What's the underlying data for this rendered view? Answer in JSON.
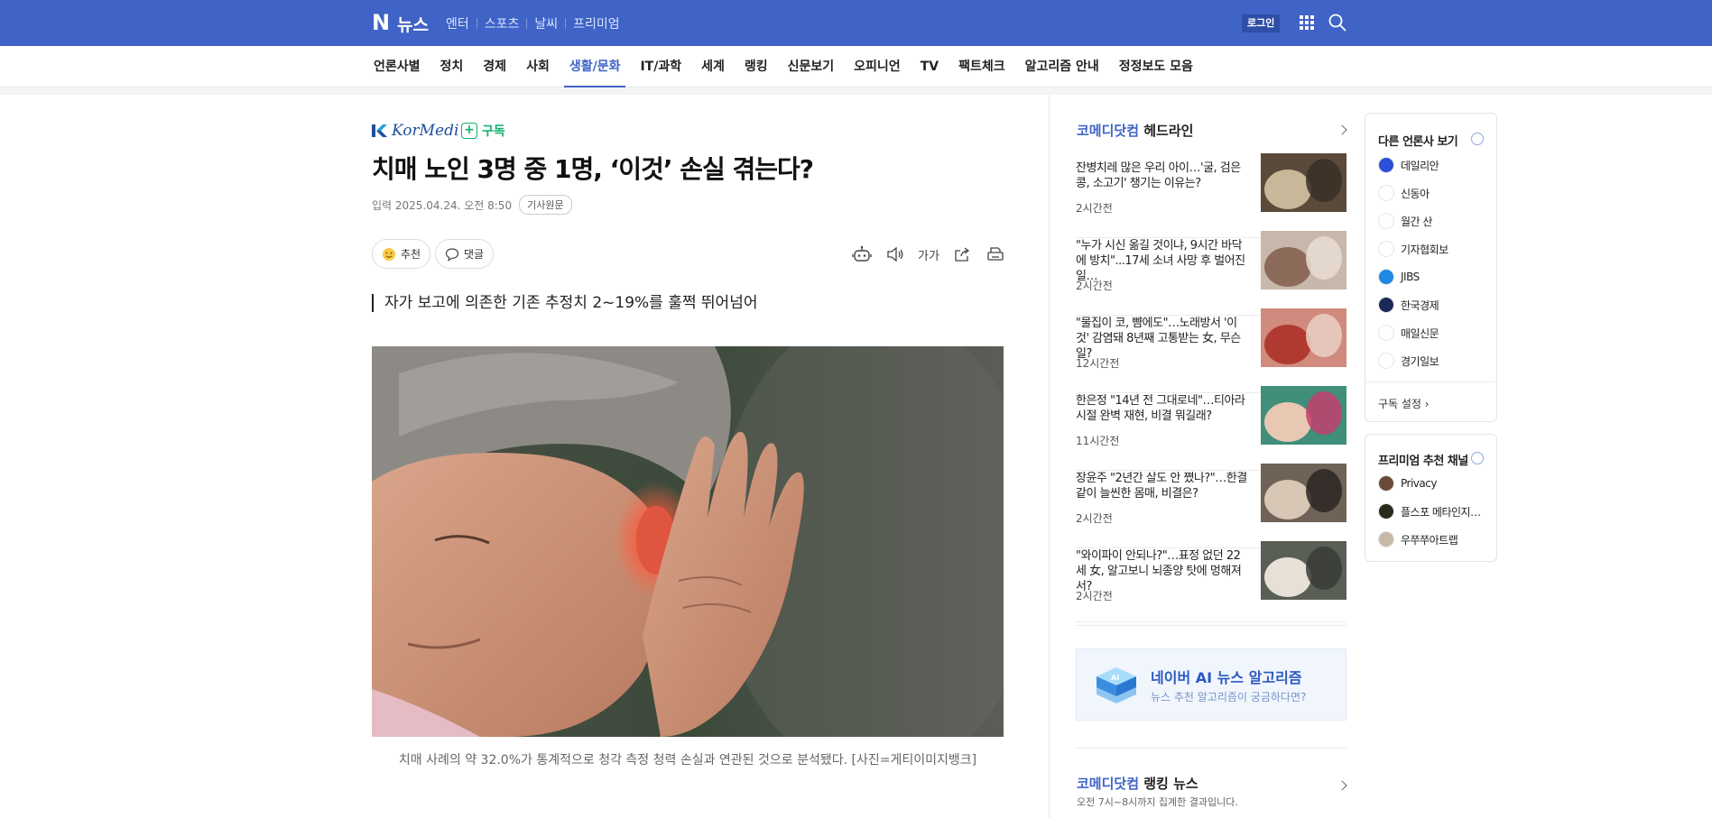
{
  "header": {
    "logo_letter": "N",
    "logo_text": "뉴스",
    "topnav": [
      "엔터",
      "스포츠",
      "날씨",
      "프리미엄"
    ],
    "login_label": "로그인"
  },
  "categories": [
    "언론사별",
    "정치",
    "경제",
    "사회",
    "생활/문화",
    "IT/과학",
    "세계",
    "랭킹",
    "신문보기",
    "오피니언",
    "TV",
    "팩트체크",
    "알고리즘 안내",
    "정정보도 모음"
  ],
  "active_category": "생활/문화",
  "article": {
    "press_name": "KorMedi",
    "subscribe_label": "구독",
    "title": "치매 노인 3명 중 1명, ‘이것’ 손실 겪는다?",
    "date_label": "입력 2025.04.24. 오전 8:50",
    "original_badge": "기사원문",
    "recommend_label": "추천",
    "comment_label": "댓글",
    "font_tool_label": "가가",
    "subtitle": "자가 보고에 의존한 기존 추정치 2~19%를 훌쩍 뛰어넘어",
    "caption": "치매 사례의 약 32.0%가 통계적으로 청각 측정 청력 손실과 연관된 것으로 분석됐다. [사진=게티이미지뱅크]"
  },
  "headlines": {
    "press": "코메디닷컴",
    "title_suffix": "헤드라인",
    "items": [
      {
        "text": "잔병치레 많은 우리 아이…'굴, 검은 콩, 소고기' 챙기는 이유는?",
        "time": "2시간전"
      },
      {
        "text": "\"누가 시신 옮길 것이냐, 9시간 바닥에 방치\"...17세 소녀 사망 후 벌어진 일…",
        "time": "2시간전"
      },
      {
        "text": "\"물집이 코, 뺨에도\"…노래방서 '이것' 감염돼 8년째 고통받는 女, 무슨 일?",
        "time": "12시간전"
      },
      {
        "text": "한은정 \"14년 전 그대로네\"…티아라 시절 완벽 재현, 비결 뭐길래?",
        "time": "11시간전"
      },
      {
        "text": "장윤주 \"2년간 살도 안 쪘나?\"…한결같이 늘씬한 몸매, 비결은?",
        "time": "2시간전"
      },
      {
        "text": "\"와이파이 안되나?\"…표정 없던 22세 女, 알고보니 뇌종양 탓에 멍해져서?",
        "time": "2시간전"
      }
    ]
  },
  "ai_banner": {
    "title": "네이버 AI 뉴스 알고리즘",
    "subtitle": "뉴스 추천 알고리즘이 궁금하다면?"
  },
  "ranking": {
    "press": "코메디닷컴",
    "title_suffix": "랭킹 뉴스",
    "subtitle": "오전 7시~8시까지 집계한 결과입니다."
  },
  "other_press": {
    "title": "다른 언론사 보기",
    "items": [
      "데일리안",
      "신동아",
      "월간 산",
      "기자협회보",
      "JIBS",
      "한국경제",
      "매일신문",
      "경기일보"
    ],
    "footer": "구독 설정"
  },
  "premium": {
    "title": "프리미엄 추천 채널",
    "items": [
      "Privacy",
      "플스포 메타인지…",
      "우쭈쭈아트랩"
    ]
  },
  "colors": {
    "brand_blue": "#3f63c6",
    "subscribe_green": "#10b06b"
  }
}
